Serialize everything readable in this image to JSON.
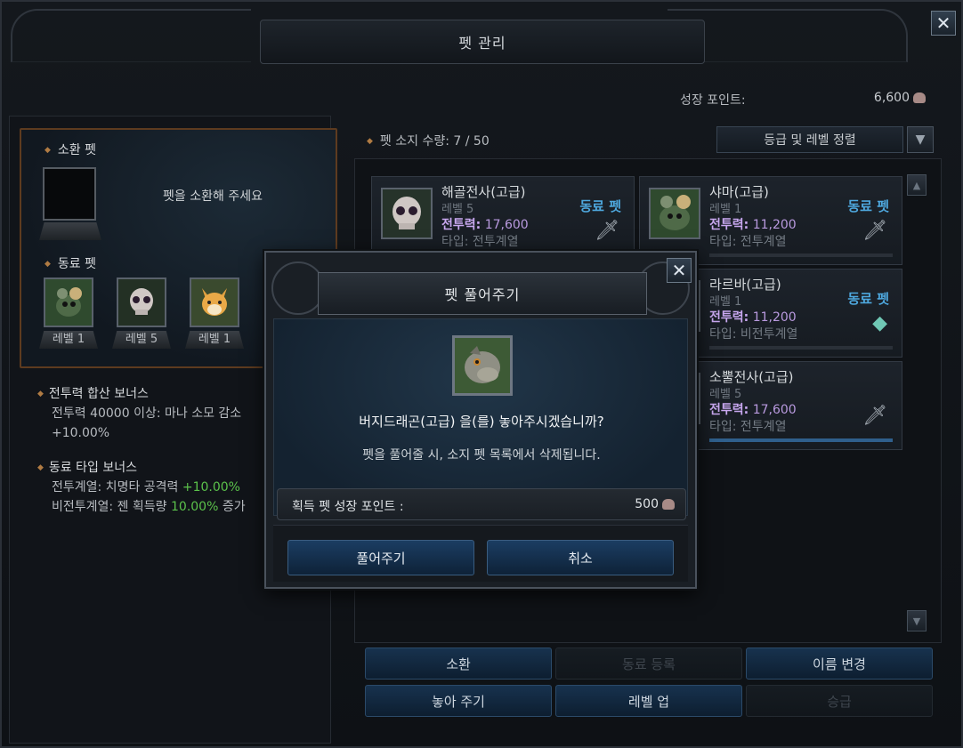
{
  "window": {
    "title": "펫 관리",
    "close_symbol": "✕"
  },
  "growth_points": {
    "label": "성장 포인트:",
    "value": "6,600"
  },
  "summon_section": {
    "title": "소환 펫",
    "empty_message": "펫을 소환해 주세요"
  },
  "companion_section": {
    "title": "동료 펫",
    "pets": [
      {
        "level": "레벨 1",
        "icon": "rat-creature-icon"
      },
      {
        "level": "레벨 5",
        "icon": "skull-warrior-icon"
      },
      {
        "level": "레벨 1",
        "icon": "fox-cub-icon"
      }
    ]
  },
  "bonuses": {
    "combat": {
      "title": "전투력 합산 보너스",
      "line1": "전투력 40000 이상: 마나 소모 감소",
      "value": "+10.00%"
    },
    "type": {
      "title": "동료 타입 보너스",
      "line1_prefix": "전투계열: 치명타 공격력 ",
      "line1_value": "+10.00%",
      "line2_prefix": "비전투계열: 젠 획득량 ",
      "line2_value": "10.00%",
      "line2_suffix": " 증가"
    }
  },
  "pet_list": {
    "count_label": "펫 소지 수량: 7 / 50",
    "sort_label": "등급 및 레벨 정렬",
    "cards": [
      {
        "name": "해골전사(고급)",
        "level": "레벨 5",
        "power_label": "전투력:",
        "power": "17,600",
        "type": "타입: 전투계열",
        "tag": "동료 펫",
        "type_icon": "sword-icon"
      },
      {
        "name": "샤마(고급)",
        "level": "레벨 1",
        "power_label": "전투력:",
        "power": "11,200",
        "type": "타입: 전투계열",
        "tag": "동료 펫",
        "type_icon": "sword-icon"
      },
      {
        "name": "라르바(고급)",
        "level": "레벨 1",
        "power_label": "전투력:",
        "power": "11,200",
        "type": "타입: 비전투계열",
        "tag": "동료 펫",
        "type_icon": "gem-icon"
      },
      {
        "name": "소뿔전사(고급)",
        "level": "레벨 5",
        "power_label": "전투력:",
        "power": "17,600",
        "type": "타입: 전투계열",
        "tag": "",
        "type_icon": "sword-icon"
      }
    ]
  },
  "actions": {
    "summon": "소환",
    "register": "동료 등록",
    "rename": "이름 변경",
    "release": "놓아 주기",
    "level_up": "레벨 업",
    "promote": "승급"
  },
  "dialog": {
    "title": "펫 풀어주기",
    "question": "버지드래곤(고급) 을(를) 놓아주시겠습니까?",
    "sub": "펫을 풀어줄 시, 소지 펫 목록에서 삭제됩니다.",
    "gain_label": "획득 펫 성장 포인트 :",
    "gain_value": "500",
    "confirm": "풀어주기",
    "cancel": "취소",
    "pet_icon": "dragon-head-icon"
  }
}
